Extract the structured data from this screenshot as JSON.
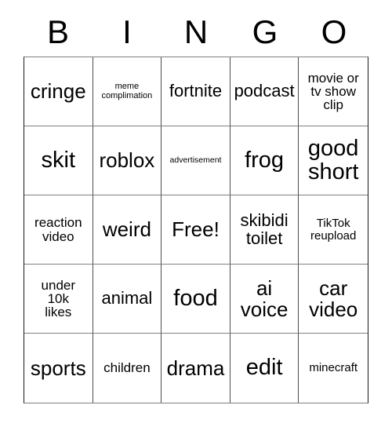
{
  "card": {
    "title_letters": [
      "B",
      "I",
      "N",
      "G",
      "O"
    ],
    "grid_size": "5x5",
    "colors": {
      "background": "#ffffff",
      "text": "#000000",
      "border": "#4d4d4d"
    },
    "cells": [
      {
        "text": "cringe",
        "size": "lg"
      },
      {
        "text": "meme\ncomplimation",
        "size": "xxs"
      },
      {
        "text": "fortnite",
        "size": "md"
      },
      {
        "text": "podcast",
        "size": "md"
      },
      {
        "text": "movie or\ntv show\nclip",
        "size": "sm"
      },
      {
        "text": "skit",
        "size": "xl"
      },
      {
        "text": "roblox",
        "size": "lg"
      },
      {
        "text": "advertisement",
        "size": "tiny"
      },
      {
        "text": "frog",
        "size": "xl"
      },
      {
        "text": "good\nshort",
        "size": "xl"
      },
      {
        "text": "reaction\nvideo",
        "size": "sm"
      },
      {
        "text": "weird",
        "size": "lg"
      },
      {
        "text": "Free!",
        "size": "lg"
      },
      {
        "text": "skibidi\ntoilet",
        "size": "md"
      },
      {
        "text": "TikTok\nreupload",
        "size": "xs"
      },
      {
        "text": "under\n10k\nlikes",
        "size": "sm"
      },
      {
        "text": "animal",
        "size": "md"
      },
      {
        "text": "food",
        "size": "xl"
      },
      {
        "text": "ai\nvoice",
        "size": "lg"
      },
      {
        "text": "car\nvideo",
        "size": "lg"
      },
      {
        "text": "sports",
        "size": "lg"
      },
      {
        "text": "children",
        "size": "sm"
      },
      {
        "text": "drama",
        "size": "lg"
      },
      {
        "text": "edit",
        "size": "xl"
      },
      {
        "text": "minecraft",
        "size": "xs"
      }
    ]
  }
}
